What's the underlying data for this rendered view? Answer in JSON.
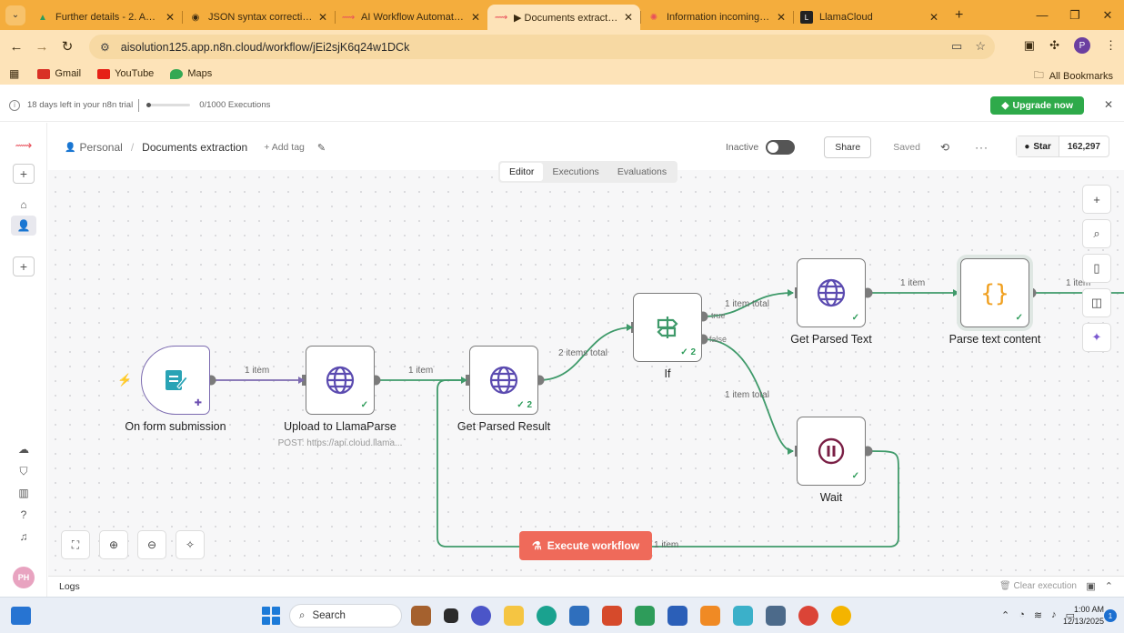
{
  "browser": {
    "tabs": [
      {
        "title": "Further details - 2. Applic",
        "icon_color": "#2e9c5a",
        "active": false
      },
      {
        "title": "JSON syntax correction",
        "icon_color": "#333333",
        "active": false
      },
      {
        "title": "AI Workflow Automation F",
        "icon_color": "#e8505b",
        "active": false
      },
      {
        "title": "▶ Documents extraction -",
        "icon_color": "#e8505b",
        "active": true
      },
      {
        "title": "Information incoming - Co",
        "icon_color": "#e8505b",
        "active": false
      },
      {
        "title": "LlamaCloud",
        "icon_color": "#222222",
        "active": false
      }
    ],
    "url": "aisolution125.app.n8n.cloud/workflow/jEi2sjK6q24w1DCk",
    "bookmarks": [
      {
        "label": "Gmail",
        "color": "#d93025"
      },
      {
        "label": "YouTube",
        "color": "#e62117"
      },
      {
        "label": "Maps",
        "color": "#34a853"
      }
    ],
    "all_bookmarks": "All Bookmarks",
    "profile_initial": "P"
  },
  "trial": {
    "days_left": "18 days left in your n8n trial",
    "executions": "0/1000 Executions",
    "upgrade_label": "Upgrade now"
  },
  "header": {
    "project": "Personal",
    "workflow_name": "Documents extraction",
    "add_tag": "+ Add tag",
    "status": "Inactive",
    "share": "Share",
    "saved": "Saved",
    "star_label": "Star",
    "star_count": "162,297"
  },
  "view_tabs": [
    "Editor",
    "Executions",
    "Evaluations"
  ],
  "workflow": {
    "nodes": [
      {
        "id": "form",
        "label": "On form submission",
        "subtitle": "",
        "icon": "form-icon"
      },
      {
        "id": "upload",
        "label": "Upload to LlamaParse",
        "subtitle": "POST: https://api.cloud.llama...",
        "icon": "globe-icon"
      },
      {
        "id": "result",
        "label": "Get Parsed Result",
        "subtitle": "",
        "icon": "globe-icon",
        "run_count": "2"
      },
      {
        "id": "if",
        "label": "If",
        "subtitle": "",
        "icon": "signpost-icon",
        "run_count": "2"
      },
      {
        "id": "text",
        "label": "Get Parsed Text",
        "subtitle": "",
        "icon": "globe-icon"
      },
      {
        "id": "code",
        "label": "Parse text content",
        "subtitle": "",
        "icon": "braces-icon"
      },
      {
        "id": "wait",
        "label": "Wait",
        "subtitle": "",
        "icon": "pause-icon"
      }
    ],
    "edges": {
      "form_upload": "1 item",
      "upload_result": "1 item",
      "result_if": "2 items total",
      "if_true": "1 item total",
      "if_false": "1 item total",
      "text_code": "1 item",
      "code_out": "1 item",
      "wait_loop": "1 item"
    },
    "ports": {
      "true": "true",
      "false": "false"
    },
    "execute_label": "Execute workflow"
  },
  "logs": {
    "label": "Logs",
    "clear": "Clear execution"
  },
  "taskbar": {
    "search": "Search",
    "time": "1:00 AM",
    "date": "12/13/2025"
  },
  "user_initials": "PH",
  "colors": {
    "tabbar": "#f4ad3d",
    "chrome": "#fde3b8",
    "upgrade": "#2eaa4a",
    "execute": "#ef6a5a",
    "wire_success": "#3f9a6a",
    "wire_trigger": "#7c6bb0"
  }
}
